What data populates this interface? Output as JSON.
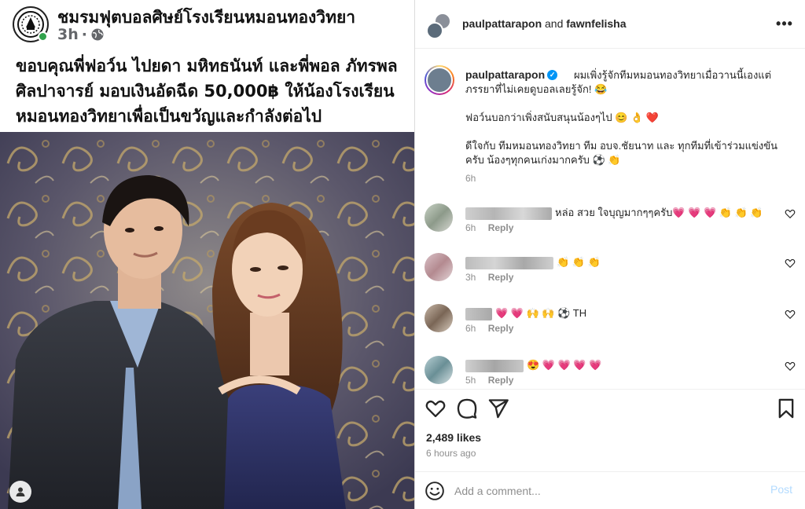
{
  "facebook_post": {
    "page_name": "ชมรมฟุตบอลศิษย์โรงเรียนหมอนทองวิทยา",
    "time": "3h",
    "separator": "·",
    "text_lines": [
      "ขอบคุณพี่ฟอว์น ไปยดา มหิทธนันท์ และพี่พอล ภัทรพล",
      "ศิลปาจารย์ มอบเงินอัดฉีด 50,000฿ ให้น้องโรงเรียน",
      "หมอนทองวิทยาเพื่อเป็นขวัญและกำลังต่อไป"
    ]
  },
  "instagram": {
    "header": {
      "user1": "paulpattarapon",
      "joiner": "and",
      "user2": "fawnfelisha",
      "more_label": "•••"
    },
    "caption": {
      "username": "paulpattarapon",
      "verified_mark": "✓",
      "para1": "ผมเพิ่งรู้จักทีมหมอนทองวิทยาเมื่อวานนี้เองแต่ภรรยาที่ไม่เคยดูบอลเลยรู้จัก! 😂",
      "para2": "ฟอว์นบอกว่าเพิ่งสนับสนุนน้องๆไป 😊 👌 ❤️",
      "para3": "ดีใจกับ ทีมหมอนทองวิทยา ทีม อบจ.ชัยนาท และ ทุกทีมที่เข้าร่วมแข่งขันครับ น้องๆทุกคนเก่งมากครับ ⚽ 👏",
      "time": "6h"
    },
    "comments": [
      {
        "text": "หล่อ สวย ใจบุญมากๆๆครับ💗 💗 💗 👏 👏 👏",
        "time": "6h",
        "reply": "Reply"
      },
      {
        "text": "👏 👏 👏",
        "time": "3h",
        "reply": "Reply"
      },
      {
        "text": "💗 💗 🙌 🙌 ⚽ TH",
        "time": "6h",
        "reply": "Reply"
      },
      {
        "text": "😍 💗 💗 💗 💗",
        "time": "5h",
        "reply": "Reply"
      }
    ],
    "likes": "2,489 likes",
    "ago": "6 hours ago",
    "comment_placeholder": "Add a comment...",
    "post_label": "Post"
  }
}
